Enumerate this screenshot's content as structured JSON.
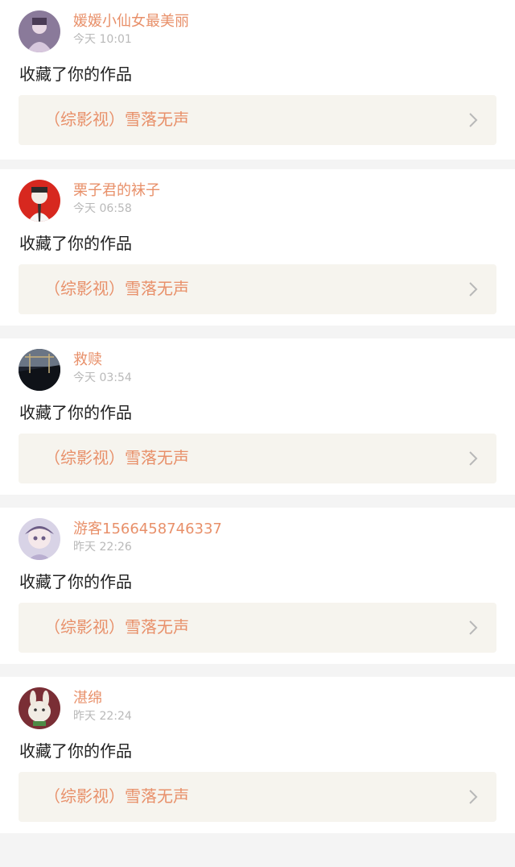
{
  "notifications": [
    {
      "username": "媛媛小仙女最美丽",
      "time": "今天 10:01",
      "action": "收藏了你的作品",
      "work_title": "（综影视）雪落无声"
    },
    {
      "username": "栗子君的袜子",
      "time": "今天 06:58",
      "action": "收藏了你的作品",
      "work_title": "（综影视）雪落无声"
    },
    {
      "username": "救赎",
      "time": "今天 03:54",
      "action": "收藏了你的作品",
      "work_title": "（综影视）雪落无声"
    },
    {
      "username": "游客1566458746337",
      "time": "昨天 22:26",
      "action": "收藏了你的作品",
      "work_title": "（综影视）雪落无声"
    },
    {
      "username": "湛绵",
      "time": "昨天 22:24",
      "action": "收藏了你的作品",
      "work_title": "（综影视）雪落无声"
    }
  ],
  "colors": {
    "accent": "#e8906a",
    "meta": "#b9b9b9",
    "link_bg": "#f6f4ee",
    "divider_bg": "#f4f4f4"
  }
}
